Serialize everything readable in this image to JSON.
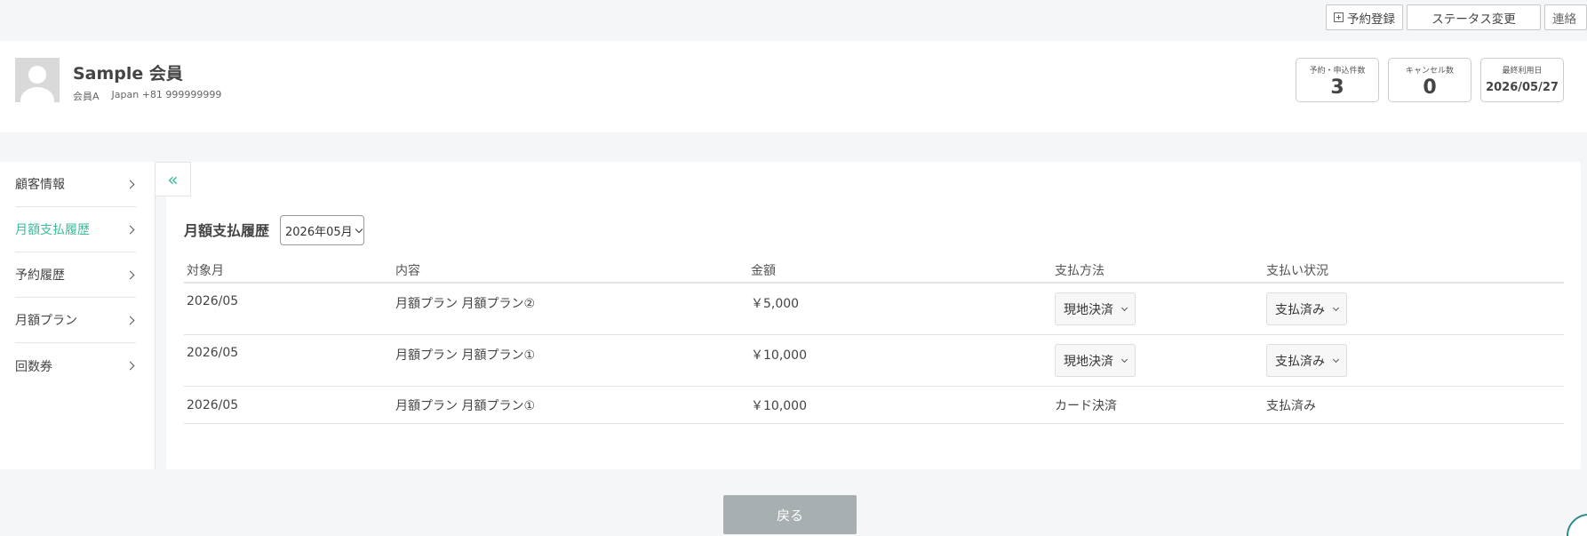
{
  "top_actions": {
    "reserve_label": "予約登録",
    "status_label": "ステータス変更",
    "contact_label": "連絡"
  },
  "member": {
    "name": "Sample 会員",
    "type": "会員A",
    "phone": "Japan +81 999999999"
  },
  "stats": [
    {
      "label": "予約・申込件数",
      "value": "3"
    },
    {
      "label": "キャンセル数",
      "value": "0"
    },
    {
      "label": "最終利用日",
      "value": "2026/05/27"
    }
  ],
  "sidebar": {
    "items": [
      {
        "label": "顧客情報"
      },
      {
        "label": "月額支払履歴"
      },
      {
        "label": "予約履歴"
      },
      {
        "label": "月額プラン"
      },
      {
        "label": "回数券"
      }
    ],
    "collapse_glyph": "«"
  },
  "main": {
    "title": "月額支払履歴",
    "month_value": "2026年05月",
    "columns": [
      "対象月",
      "内容",
      "金額",
      "支払方法",
      "支払い状況"
    ],
    "rows": [
      {
        "month": "2026/05",
        "content": "月額プラン 月額プラン②",
        "amount": "￥5,000",
        "method": "現地決済",
        "status": "支払済み"
      },
      {
        "month": "2026/05",
        "content": "月額プラン 月額プラン①",
        "amount": "￥10,000",
        "method": "現地決済",
        "status": "支払済み"
      },
      {
        "month": "2026/05",
        "content": "月額プラン 月額プラン①",
        "amount": "￥10,000",
        "method": "カード決済",
        "status": "支払済み"
      }
    ]
  },
  "back_label": "戻る",
  "colors": {
    "accent": "#3dbb9c",
    "back_button": "#a7afb0"
  }
}
